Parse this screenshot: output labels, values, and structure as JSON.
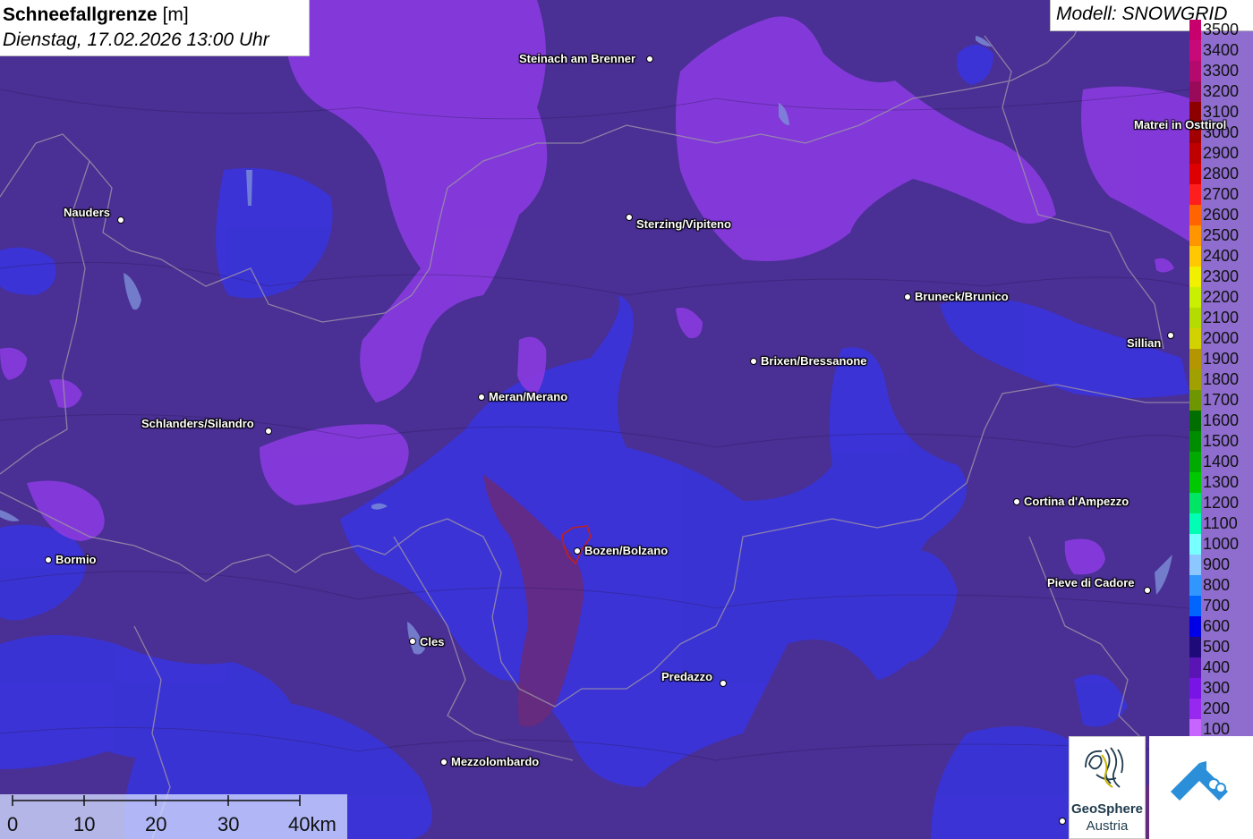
{
  "header": {
    "parameter": "Schneefallgrenze",
    "unit": "[m]",
    "datetime": "Dienstag, 17.02.2026 13:00 Uhr"
  },
  "model": {
    "label": "Modell: SNOWGRID"
  },
  "legend": {
    "items": [
      {
        "value": "3500",
        "color": "#c8006e"
      },
      {
        "value": "3400",
        "color": "#c80a78"
      },
      {
        "value": "3300",
        "color": "#b40a6e"
      },
      {
        "value": "3200",
        "color": "#9a0a5a"
      },
      {
        "value": "3100",
        "color": "#8c0000"
      },
      {
        "value": "3000",
        "color": "#a00000"
      },
      {
        "value": "2900",
        "color": "#be0000"
      },
      {
        "value": "2800",
        "color": "#dc0000"
      },
      {
        "value": "2700",
        "color": "#ff1e1e"
      },
      {
        "value": "2600",
        "color": "#ff6400"
      },
      {
        "value": "2500",
        "color": "#ff9600"
      },
      {
        "value": "2400",
        "color": "#ffc800"
      },
      {
        "value": "2300",
        "color": "#f0f000"
      },
      {
        "value": "2200",
        "color": "#c8f000"
      },
      {
        "value": "2100",
        "color": "#b4dc00"
      },
      {
        "value": "2000",
        "color": "#d2d200"
      },
      {
        "value": "1900",
        "color": "#b49600"
      },
      {
        "value": "1800",
        "color": "#a0a000"
      },
      {
        "value": "1700",
        "color": "#6e9600"
      },
      {
        "value": "1600",
        "color": "#006e00"
      },
      {
        "value": "1500",
        "color": "#008c00"
      },
      {
        "value": "1400",
        "color": "#00aa00"
      },
      {
        "value": "1300",
        "color": "#00c800"
      },
      {
        "value": "1200",
        "color": "#00e664"
      },
      {
        "value": "1100",
        "color": "#00ffb4"
      },
      {
        "value": "1000",
        "color": "#78ffff"
      },
      {
        "value": "900",
        "color": "#8cc8ff"
      },
      {
        "value": "800",
        "color": "#3296ff"
      },
      {
        "value": "700",
        "color": "#0064ff"
      },
      {
        "value": "600",
        "color": "#0000e6"
      },
      {
        "value": "500",
        "color": "#1e0a78"
      },
      {
        "value": "400",
        "color": "#5a14b4"
      },
      {
        "value": "300",
        "color": "#7814e6"
      },
      {
        "value": "200",
        "color": "#9628f0"
      },
      {
        "value": "100",
        "color": "#c864ff"
      }
    ]
  },
  "cities": [
    {
      "name": "Steinach am Brenner"
    },
    {
      "name": "Nauders"
    },
    {
      "name": "Sterzing/Vipiteno"
    },
    {
      "name": "Matrei in Osttirol"
    },
    {
      "name": "Bruneck/Brunico"
    },
    {
      "name": "Sillian"
    },
    {
      "name": "Brixen/Bressanone"
    },
    {
      "name": "Meran/Merano"
    },
    {
      "name": "Schlanders/Silandro"
    },
    {
      "name": "Cortina d'Ampezzo"
    },
    {
      "name": "Bozen/Bolzano"
    },
    {
      "name": "Bormio"
    },
    {
      "name": "Pieve di Cadore"
    },
    {
      "name": "Cles"
    },
    {
      "name": "Predazzo"
    },
    {
      "name": "Mezzolombardo"
    }
  ],
  "scale_bar": {
    "labels": [
      "0",
      "10",
      "20",
      "30",
      "40km"
    ]
  },
  "logos": {
    "geosphere": {
      "line1": "GeoSphere",
      "line2": "Austria"
    }
  },
  "colors": {
    "snowline_low_blue": "#3c32d2",
    "snowline_mid_indigo": "#4a2f94",
    "snowline_high_violet": "#8a3be0",
    "valley_maroon": "#6a2a7a"
  }
}
